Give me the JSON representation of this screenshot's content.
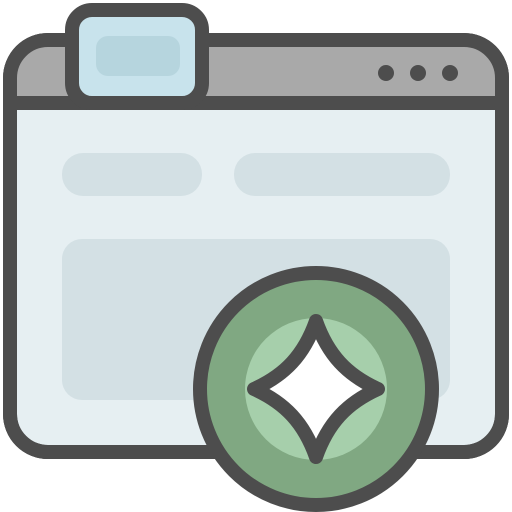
{
  "icon": {
    "name": "browser-window-sparkle-icon",
    "window_controls": [
      "dot",
      "dot",
      "dot"
    ],
    "colors": {
      "outline": "#4d4d4d",
      "titlebar": "#a9a9a9",
      "tab_outer": "#c8e3ec",
      "tab_inner": "#b6d5de",
      "window_body": "#e6eff2",
      "placeholder": "#d3e0e4",
      "badge_outer": "#80a882",
      "badge_inner": "#a6cfab",
      "sparkle": "#ffffff"
    }
  }
}
